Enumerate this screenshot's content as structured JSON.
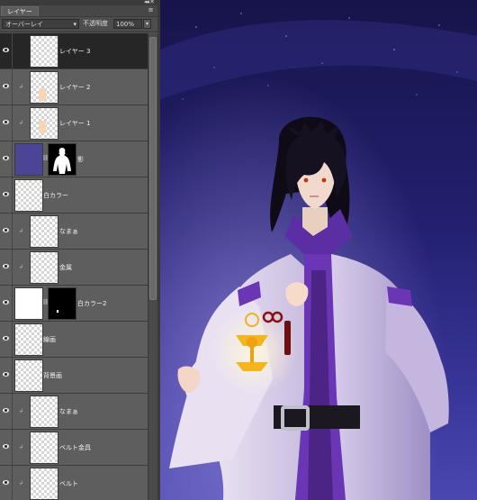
{
  "panel": {
    "collapse_icon": "double-chevron-right",
    "tab_label": "レイヤー",
    "menu_icon": "panel-menu-icon",
    "blend_mode": "オーバーレイ",
    "opacity_label": "不透明度",
    "opacity_value": "100%"
  },
  "layers": [
    {
      "name": "レイヤー 3",
      "selected": true
    },
    {
      "name": "レイヤー 2",
      "selected": false
    },
    {
      "name": "レイヤー 1",
      "selected": false
    },
    {
      "name": "影",
      "selected": false
    },
    {
      "name": "白カラー",
      "selected": false
    },
    {
      "name": "なまぁ",
      "selected": false
    },
    {
      "name": "金属",
      "selected": false
    },
    {
      "name": "白カラー2",
      "selected": false
    },
    {
      "name": "線画",
      "selected": false
    },
    {
      "name": "背景画",
      "selected": false
    },
    {
      "name": "なまぁ",
      "selected": false
    },
    {
      "name": "ベルト金具",
      "selected": false
    },
    {
      "name": "ベルト",
      "selected": false
    }
  ],
  "colors": {
    "panel_bg": "#5e5e5e",
    "selected_row": "#262626",
    "sky_top": "#1a1752",
    "sky_bottom": "#3e3aa0",
    "robe": "#e4dcef",
    "robe_purple": "#6a36b5",
    "ornament": "#f0b020"
  }
}
